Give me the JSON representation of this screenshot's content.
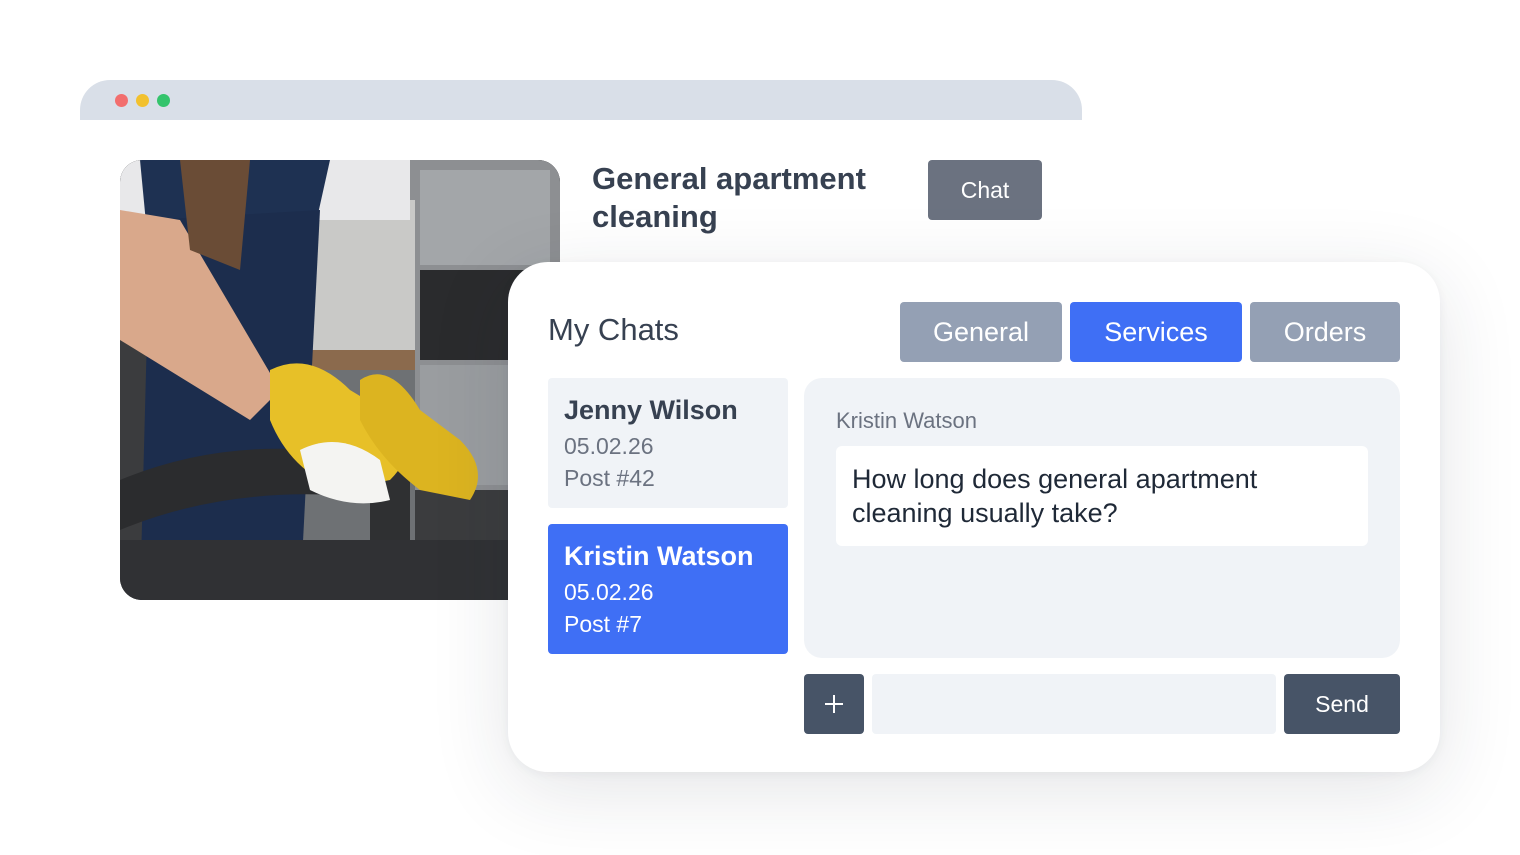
{
  "browser": {
    "window_controls": [
      "close-dot",
      "minimize-dot",
      "maximize-dot"
    ]
  },
  "listing": {
    "title": "General apartment cleaning",
    "chat_button_label": "Chat",
    "image_alt": "cleaner-with-yellow-gloves-photo"
  },
  "chats_panel": {
    "title": "My Chats",
    "tabs": [
      {
        "label": "General",
        "active": false
      },
      {
        "label": "Services",
        "active": true
      },
      {
        "label": "Orders",
        "active": false
      }
    ],
    "conversations": [
      {
        "name": "Jenny Wilson",
        "date": "05.02.26",
        "post": "Post #42",
        "selected": false
      },
      {
        "name": "Kristin Watson",
        "date": "05.02.26",
        "post": "Post #7",
        "selected": true
      }
    ],
    "active_thread": {
      "sender": "Kristin Watson",
      "message": "How long does general apartment cleaning usually take?"
    },
    "composer": {
      "attach_icon": "plus-icon",
      "input_value": "",
      "input_placeholder": "",
      "send_label": "Send"
    }
  },
  "colors": {
    "accent": "#3f6ff5",
    "tab_inactive": "#94a0b4",
    "dark_button": "#475467",
    "chat_button": "#6b7280",
    "panel_bg": "#f0f3f7"
  }
}
